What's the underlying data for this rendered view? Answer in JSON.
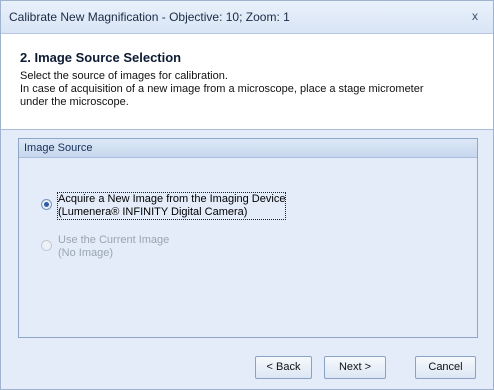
{
  "window": {
    "title": "Calibrate New Magnification - Objective: 10; Zoom: 1",
    "close_glyph": "x"
  },
  "header": {
    "step_title": "2. Image Source Selection",
    "desc_line1": "Select the source of images for calibration.",
    "desc_line2": "In case of acquisition of a new image from a microscope, place a stage micrometer",
    "desc_line3": "under the microscope."
  },
  "group": {
    "title": "Image Source",
    "options": [
      {
        "line1": "Acquire a New Image from the Imaging Device",
        "line2": "(Lumenera® INFINITY Digital Camera)",
        "checked": true,
        "enabled": true
      },
      {
        "line1": "Use the Current Image",
        "line2": "(No Image)",
        "checked": false,
        "enabled": false
      }
    ]
  },
  "buttons": {
    "back": "< Back",
    "next": "Next >",
    "cancel": "Cancel"
  }
}
